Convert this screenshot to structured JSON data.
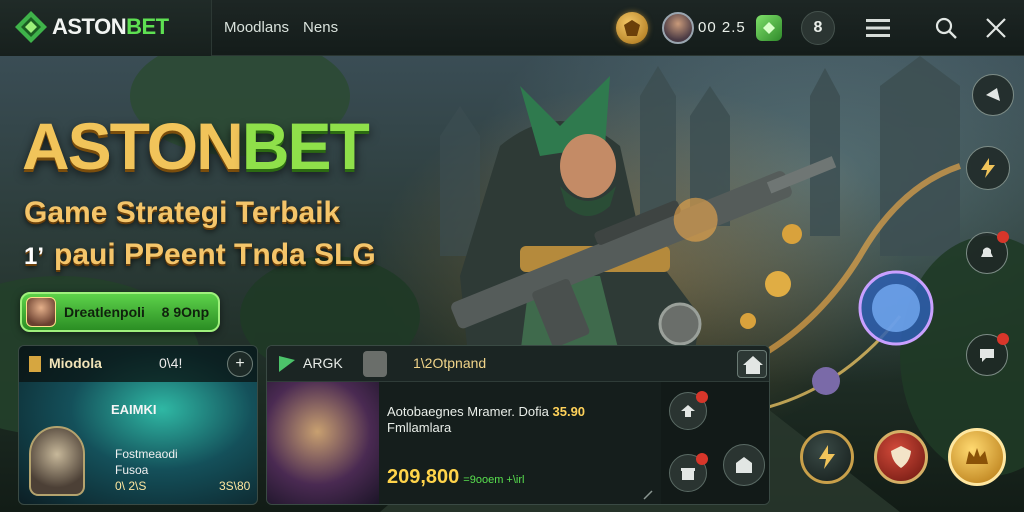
{
  "header": {
    "logo_main": "ASTON",
    "logo_accent": "BET",
    "nav": [
      "Moodlans",
      "Nens"
    ],
    "balance": "00 2.5",
    "lock_glyph": "8"
  },
  "hero": {
    "title_main": "ASTON",
    "title_accent": "BET",
    "subtitle_1": "Game Strategi Terbaik",
    "subtitle_2_mark": "1’",
    "subtitle_2": "paui PPeent Tnda SLG",
    "cta_label": "Dreatlenpoli ﾠ8 9Onp"
  },
  "card_left": {
    "title": "Miodola",
    "count": "0\\4!",
    "plus": "+",
    "center_label": "EAIMKI",
    "name_line1": "Fostmeaodi",
    "name_line2": "Fusoa",
    "stat_1": "0\\ 2\\S",
    "stat_2": "3S\\80"
  },
  "card_right": {
    "tab_a": "ARGK",
    "tab_b": "1\\2Otpnand",
    "desc_line1": "Aotobaegnes Mramer. Dofia",
    "desc_price": "35.90",
    "desc_line2": "Fmllamlara",
    "pot_value": "209,800",
    "pot_note": "=9ooem +\\irl"
  },
  "colors": {
    "accent_green": "#5ee052",
    "accent_gold": "#f1c45a",
    "badge_red": "#d8362a"
  },
  "icons": {
    "logo": "astonbet-logo-icon",
    "coin": "coin-icon",
    "gem": "gem-icon",
    "menu": "hamburger-icon",
    "search": "search-icon",
    "close": "close-icon"
  }
}
